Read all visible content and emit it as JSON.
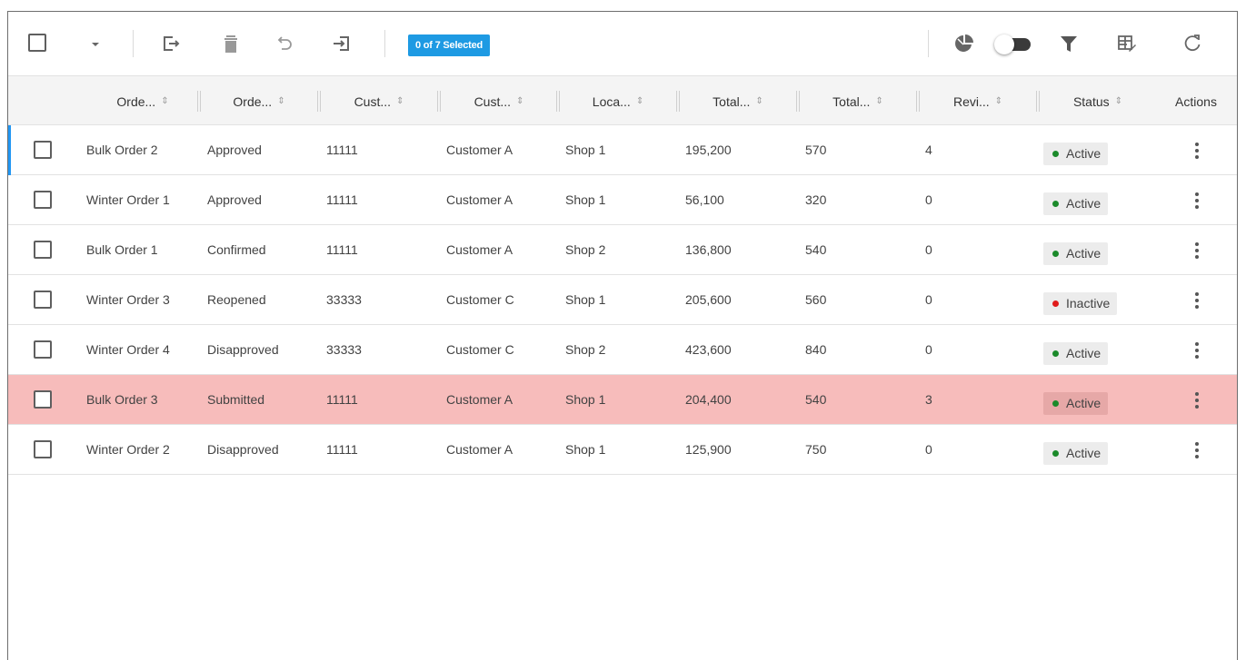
{
  "toolbar": {
    "selection_badge": "0 of 7 Selected",
    "icons": [
      "select-all-checkbox",
      "dropdown-caret-icon",
      "export-icon",
      "delete-icon",
      "undo-icon",
      "import-icon",
      "pie-chart-icon",
      "toggle-switch",
      "filter-icon",
      "column-settings-icon",
      "refresh-icon"
    ]
  },
  "table": {
    "headers": {
      "order_name": "Orde...",
      "order_status": "Orde...",
      "customer_id": "Cust...",
      "customer_name": "Cust...",
      "location": "Loca...",
      "total_amount": "Total...",
      "total_qty": "Total...",
      "revision": "Revi...",
      "status": "Status",
      "actions": "Actions"
    },
    "rows": [
      {
        "name": "Bulk Order 2",
        "order_status": "Approved",
        "customer_id": "11111",
        "customer": "Customer A",
        "location": "Shop 1",
        "total_amount": "195,200",
        "total_qty": "570",
        "revision": "4",
        "status": "Active"
      },
      {
        "name": "Winter Order 1",
        "order_status": "Approved",
        "customer_id": "11111",
        "customer": "Customer A",
        "location": "Shop 1",
        "total_amount": "56,100",
        "total_qty": "320",
        "revision": "0",
        "status": "Active"
      },
      {
        "name": "Bulk Order 1",
        "order_status": "Confirmed",
        "customer_id": "11111",
        "customer": "Customer A",
        "location": "Shop 2",
        "total_amount": "136,800",
        "total_qty": "540",
        "revision": "0",
        "status": "Active"
      },
      {
        "name": "Winter Order 3",
        "order_status": "Reopened",
        "customer_id": "33333",
        "customer": "Customer C",
        "location": "Shop 1",
        "total_amount": "205,600",
        "total_qty": "560",
        "revision": "0",
        "status": "Inactive"
      },
      {
        "name": "Winter Order 4",
        "order_status": "Disapproved",
        "customer_id": "33333",
        "customer": "Customer C",
        "location": "Shop 2",
        "total_amount": "423,600",
        "total_qty": "840",
        "revision": "0",
        "status": "Active"
      },
      {
        "name": "Bulk Order 3",
        "order_status": "Submitted",
        "customer_id": "11111",
        "customer": "Customer A",
        "location": "Shop 1",
        "total_amount": "204,400",
        "total_qty": "540",
        "revision": "3",
        "status": "Active"
      },
      {
        "name": "Winter Order 2",
        "order_status": "Disapproved",
        "customer_id": "11111",
        "customer": "Customer A",
        "location": "Shop 1",
        "total_amount": "125,900",
        "total_qty": "750",
        "revision": "0",
        "status": "Active"
      }
    ],
    "highlighted_row": 5,
    "accent_row": 0
  },
  "colors": {
    "accent_blue": "#1e9ae3",
    "highlight_row": "#f7bcbb",
    "active_dot": "#1b8a2a",
    "inactive_dot": "#e01b1b"
  }
}
